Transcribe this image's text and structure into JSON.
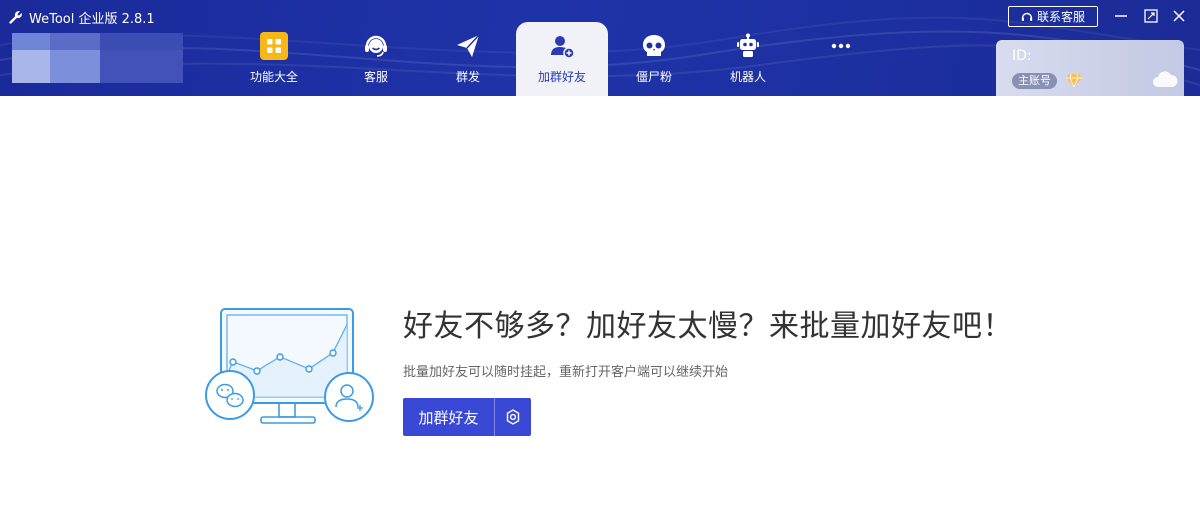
{
  "app": {
    "title": "WeTool 企业版 2.8.1"
  },
  "nav": {
    "tabs": [
      {
        "label": "功能大全",
        "icon": "grid-icon"
      },
      {
        "label": "客服",
        "icon": "headset-icon"
      },
      {
        "label": "群发",
        "icon": "paper-plane-icon"
      },
      {
        "label": "加群好友",
        "icon": "add-user-icon",
        "active": true
      },
      {
        "label": "僵尸粉",
        "icon": "skull-icon"
      },
      {
        "label": "机器人",
        "icon": "robot-icon"
      },
      {
        "label": "",
        "icon": "more-dots-icon"
      }
    ]
  },
  "topbar": {
    "contact_label": "联系客服"
  },
  "account": {
    "id_label": "ID:",
    "badge": "主账号"
  },
  "main": {
    "headline": "好友不够多？加好友太慢？来批量加好友吧！",
    "subtext": "批量加好友可以随时挂起，重新打开客户端可以继续开始",
    "primary_button": "加群好友"
  },
  "colors": {
    "header": "#1f33a8",
    "accent": "#3a48d6",
    "illustration": "#3b9be6"
  }
}
